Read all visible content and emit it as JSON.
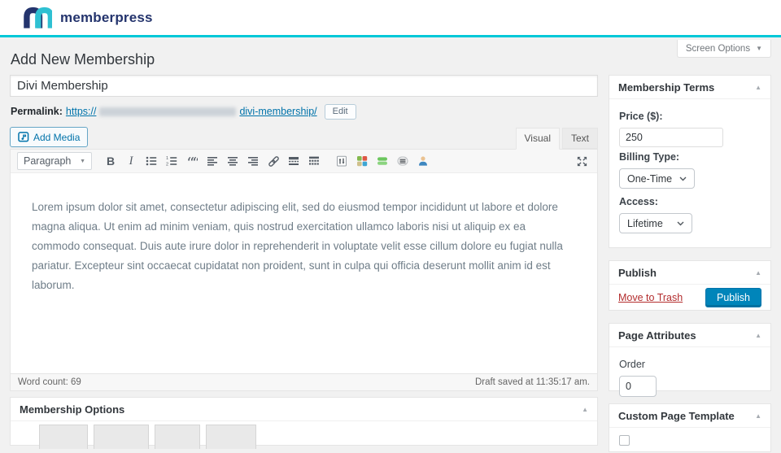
{
  "brand": {
    "name": "memberpress"
  },
  "screen_options": {
    "label": "Screen Options"
  },
  "page_title": "Add New Membership",
  "post": {
    "title": "Divi Membership",
    "permalink_label": "Permalink:",
    "permalink_prefix": "https://",
    "permalink_slug": "divi-membership/",
    "edit_button": "Edit"
  },
  "editor": {
    "add_media": "Add Media",
    "visual_tab": "Visual",
    "text_tab": "Text",
    "paragraph": "Paragraph",
    "bold_glyph": "B",
    "italic_glyph": "I",
    "quote_glyph": "““",
    "content": "Lorem ipsum dolor sit amet, consectetur adipiscing elit, sed do eiusmod tempor incididunt ut labore et dolore magna aliqua. Ut enim ad minim veniam, quis nostrud exercitation ullamco laboris nisi ut aliquip ex ea commodo consequat. Duis aute irure dolor in reprehenderit in voluptate velit esse cillum dolore eu fugiat nulla pariatur. Excepteur sint occaecat cupidatat non proident, sunt in culpa qui officia deserunt mollit anim id est laborum.",
    "word_count": "Word count: 69",
    "draft_saved": "Draft saved at 11:35:17 am."
  },
  "membership_options_panel": {
    "title": "Membership Options"
  },
  "sidebar": {
    "membership_terms": {
      "title": "Membership Terms",
      "price_label": "Price ($):",
      "price_value": "250",
      "billing_label": "Billing Type:",
      "billing_value": "One-Time",
      "access_label": "Access:",
      "access_value": "Lifetime"
    },
    "publish": {
      "title": "Publish",
      "move_to_trash": "Move to Trash",
      "publish_button": "Publish"
    },
    "page_attributes": {
      "title": "Page Attributes",
      "order_label": "Order",
      "order_value": "0"
    },
    "custom_page_template": {
      "title": "Custom Page Template"
    }
  },
  "icons": {
    "caret_down": "▼",
    "collapse_glyph": "▲"
  },
  "colors": {
    "accent_line": "#00c8d8",
    "brand_navy": "#24346d",
    "brand_teal": "#2fc0d2",
    "publish_blue": "#0085ba",
    "link_blue": "#0073aa",
    "trash_red": "#b32d2e"
  }
}
